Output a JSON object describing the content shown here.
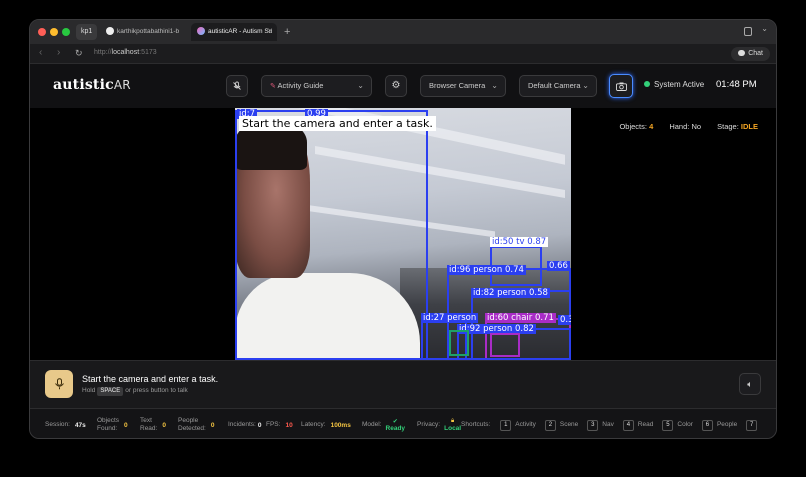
{
  "browser": {
    "profile": "kp1",
    "tabs": [
      {
        "title": "karthikpottabathini1-b"
      },
      {
        "title": "autisticAR - Autism Su"
      }
    ],
    "url_host": "localhost",
    "url_port": ":5173",
    "url_prefix": "http://",
    "chat_label": "Chat"
  },
  "header": {
    "logo_main": "autistic",
    "logo_suffix": "AR",
    "activity_select": "Activity Guide",
    "camera_source": "Browser Camera",
    "camera_device": "Default Camera",
    "status": "System Active",
    "time": "01:48 PM",
    "accent_color": "#4a8cff",
    "status_color": "#33d17a"
  },
  "stage": {
    "overlay_text": "Start the camera and enter a task.",
    "stats": {
      "objects_label": "Objects:",
      "objects_value": "4",
      "hand_label": "Hand:",
      "hand_value": "No",
      "stage_label": "Stage:",
      "stage_value": "IDLE"
    },
    "detections": [
      {
        "label": "id:50 tv 0.87"
      },
      {
        "label": "id:96 person 0.74"
      },
      {
        "label": "0.66"
      },
      {
        "label": "id:82 person 0.58"
      },
      {
        "label": "id:27 person"
      },
      {
        "label": "id:60 chair 0.71"
      },
      {
        "label": "0.3"
      },
      {
        "label": "id:92 person 0.82"
      },
      {
        "label": "id:7"
      },
      {
        "label": "0.99"
      }
    ]
  },
  "prompt": {
    "message": "Start the camera and enter a task.",
    "hint_pre": "Hold",
    "hint_key": "SPACE",
    "hint_post": "or press button to talk"
  },
  "footer": {
    "session_label": "Session:",
    "session_value": "47s",
    "objects_label_1": "Objects",
    "objects_label_2": "Found:",
    "objects_value": "0",
    "text_label_1": "Text",
    "text_label_2": "Read:",
    "text_value": "0",
    "people_label_1": "People",
    "people_label_2": "Detected:",
    "people_value": "0",
    "incidents_label": "Incidents:",
    "incidents_value": "0",
    "fps_label": "FPS:",
    "fps_value": "10",
    "latency_label": "Latency:",
    "latency_value": "100ms",
    "model_label": "Model:",
    "model_value": "Ready",
    "privacy_label": "Privacy:",
    "privacy_value": "Local",
    "shortcuts_label": "Shortcuts:",
    "shortcuts": [
      {
        "key": "1",
        "label": "Activity"
      },
      {
        "key": "2",
        "label": "Scene"
      },
      {
        "key": "3",
        "label": "Nav"
      },
      {
        "key": "4",
        "label": "Read"
      },
      {
        "key": "5",
        "label": "Color"
      },
      {
        "key": "6",
        "label": "People"
      },
      {
        "key": "7",
        "label": ""
      }
    ]
  }
}
